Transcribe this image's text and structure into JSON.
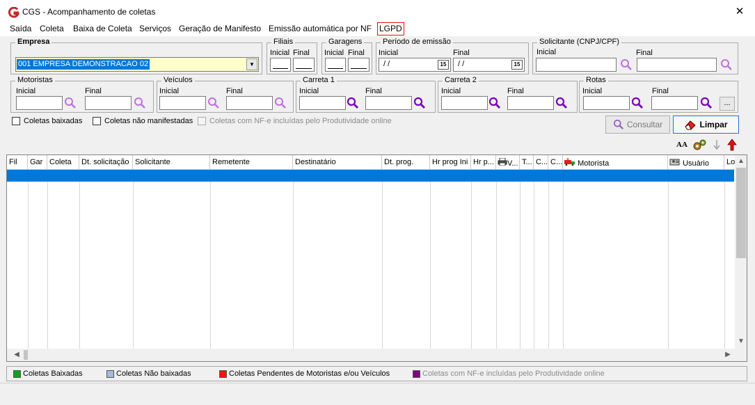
{
  "window": {
    "title": "CGS - Acompanhamento de coletas"
  },
  "menu": [
    "Saída",
    "Coleta",
    "Baixa de Coleta",
    "Serviços",
    "Geração de Manifesto",
    "Emissão automática por NF",
    "LGPD"
  ],
  "filters": {
    "empresa": {
      "title": "Empresa",
      "value": "001 EMPRESA DEMONSTRACAO 02"
    },
    "filiais": {
      "title": "Filiais",
      "inicial": "Inicial",
      "final": "Final"
    },
    "garagens": {
      "title": "Garagens",
      "inicial": "Inicial",
      "final": "Final"
    },
    "periodo": {
      "title": "Período de emissão",
      "inicial": "Inicial",
      "final": "Final",
      "inicial_value": "/ /",
      "final_value": "/ /",
      "cal_icon": "15"
    },
    "solicitante": {
      "title": "Solicitante (CNPJ/CPF)",
      "inicial": "Inicial",
      "final": "Final"
    },
    "motoristas": {
      "title": "Motoristas",
      "inicial": "Inicial",
      "final": "Final"
    },
    "veiculos": {
      "title": "Veículos",
      "inicial": "Inicial",
      "final": "Final"
    },
    "carreta1": {
      "title": "Carreta 1",
      "inicial": "Inicial",
      "final": "Final"
    },
    "carreta2": {
      "title": "Carreta 2",
      "inicial": "Inicial",
      "final": "Final"
    },
    "rotas": {
      "title": "Rotas",
      "inicial": "Inicial",
      "final": "Final",
      "more": "..."
    }
  },
  "checkboxes": [
    {
      "label": "Coletas baixadas",
      "checked": false,
      "enabled": true
    },
    {
      "label": "Coletas não manifestadas",
      "checked": false,
      "enabled": true
    },
    {
      "label": "Coletas com NF-e incluídas pelo Produtividade online",
      "checked": false,
      "enabled": false
    }
  ],
  "buttons": {
    "consultar": "Consultar",
    "limpar": "Limpar"
  },
  "toolbar": {
    "font_icon_text": "AA"
  },
  "grid": {
    "columns": [
      "Fil",
      "Gar",
      "Coleta",
      "Dt. solicitação",
      "Solicitante",
      "Remetente",
      "Destinatário",
      "Dt. prog.",
      "Hr prog Ini",
      "Hr p...",
      "V...",
      "T...",
      "C...",
      "C...",
      "Motorista",
      "Usuário",
      "Lo"
    ]
  },
  "legend": [
    {
      "label": "Coletas Baixadas",
      "color": "#14a01e",
      "enabled": true
    },
    {
      "label": "Coletas Não baixadas",
      "color": "#a3bcd8",
      "enabled": true
    },
    {
      "label": "Coletas Pendentes de Motoristas e/ou Veículos",
      "color": "#ff1010",
      "enabled": true
    },
    {
      "label": "Coletas com NF-e incluídas pelo Produtividade online",
      "color": "#800080",
      "enabled": false
    }
  ],
  "colors": {
    "selection": "#0078d7",
    "lgpd_border": "#e01010",
    "search_icon": "#8a00c8"
  }
}
